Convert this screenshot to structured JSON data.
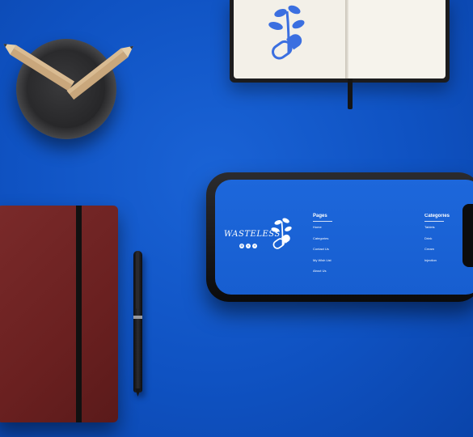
{
  "colors": {
    "background": "#1258c8",
    "screen": "#1a62d5",
    "notebook_red": "#6e2222",
    "logo_blue": "#3b6fe0"
  },
  "phone": {
    "brand": "WASTELESS",
    "social_icons": [
      "google-plus-icon",
      "twitter-icon",
      "facebook-icon"
    ],
    "pages": {
      "title": "Pages",
      "items": [
        "Home",
        "Categories",
        "Contact Us",
        "My Wish List",
        "About Us"
      ]
    },
    "categories": {
      "title": "Categories",
      "items": [
        "Tablets",
        "Drink",
        "Cream",
        "Injection"
      ]
    }
  },
  "notebook": {
    "logo": "plant-capsule-logo-icon"
  }
}
